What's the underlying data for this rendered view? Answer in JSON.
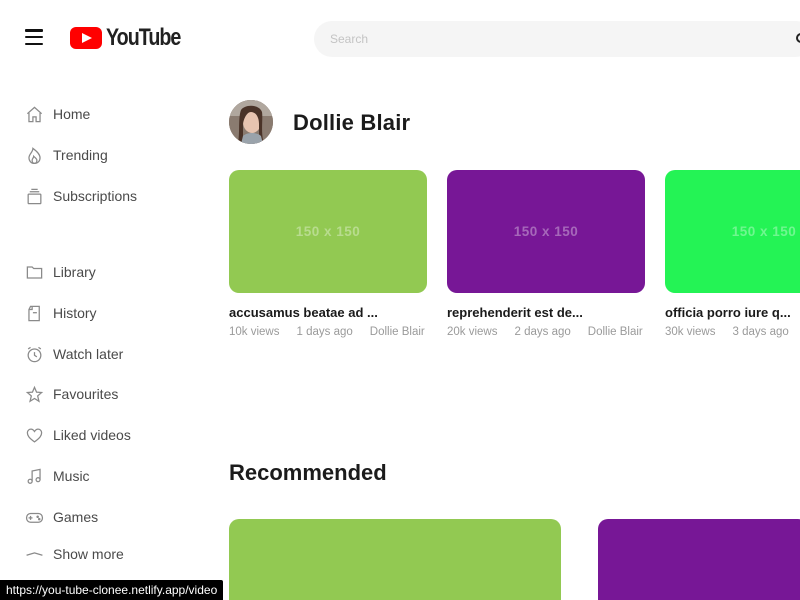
{
  "header": {
    "logo_text": "YouTube",
    "search_placeholder": "Search"
  },
  "sidebar": {
    "items": [
      {
        "label": "Home",
        "icon": "home-icon"
      },
      {
        "label": "Trending",
        "icon": "flame-icon"
      },
      {
        "label": "Subscriptions",
        "icon": "subscriptions-icon"
      },
      {
        "label": "Library",
        "icon": "folder-icon"
      },
      {
        "label": "History",
        "icon": "history-icon"
      },
      {
        "label": "Watch later",
        "icon": "clock-icon"
      },
      {
        "label": "Favourites",
        "icon": "star-icon"
      },
      {
        "label": "Liked videos",
        "icon": "heart-icon"
      },
      {
        "label": "Music",
        "icon": "music-icon"
      },
      {
        "label": "Games",
        "icon": "gamepad-icon"
      },
      {
        "label": "Show more",
        "icon": "chevron-up-icon"
      }
    ]
  },
  "channel": {
    "name": "Dollie Blair"
  },
  "videos": [
    {
      "thumb_text": "150 x 150",
      "color": "#92c952",
      "title": "accusamus beatae ad ...",
      "views": "10k views",
      "age": "1 days ago",
      "channel": "Dollie Blair"
    },
    {
      "thumb_text": "150 x 150",
      "color": "#771796",
      "title": "reprehenderit est de...",
      "views": "20k views",
      "age": "2 days ago",
      "channel": "Dollie Blair"
    },
    {
      "thumb_text": "150 x 150",
      "color": "#24f355",
      "title": "officia porro iure q...",
      "views": "30k views",
      "age": "3 days ago",
      "channel": ""
    }
  ],
  "recommended": {
    "title": "Recommended",
    "colors": [
      "#92c952",
      "#771796"
    ]
  },
  "status_bar": {
    "url": "https://you-tube-clonee.netlify.app/video"
  }
}
